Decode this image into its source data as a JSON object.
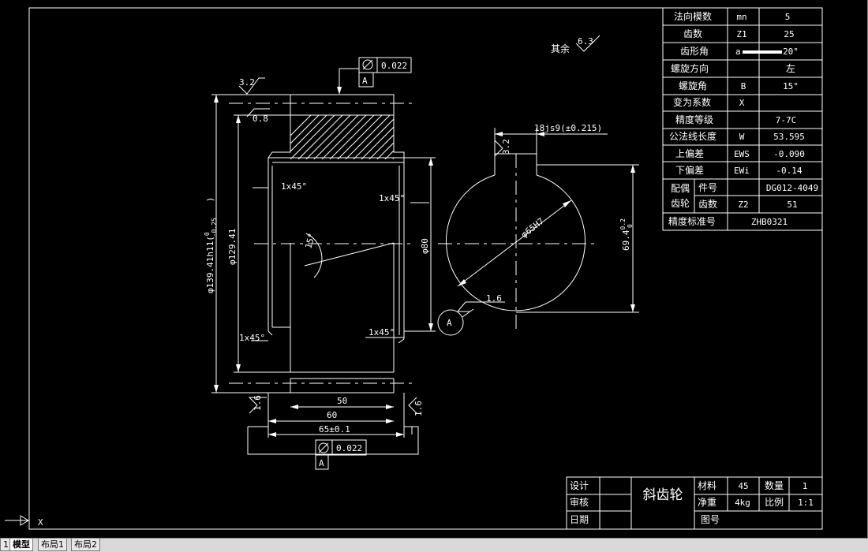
{
  "params": [
    {
      "name": "法向模数",
      "sym": "mn",
      "val": "5"
    },
    {
      "name": "齿数",
      "sym": "Z1",
      "val": "25"
    },
    {
      "name": "齿形角",
      "sym": "",
      "val": "20°"
    },
    {
      "name": "螺旋方向",
      "sym": "",
      "val": "左"
    },
    {
      "name": "螺旋角",
      "sym": "B",
      "val": "15°"
    },
    {
      "name": "变为系数",
      "sym": "X",
      "val": ""
    },
    {
      "name": "精度等级",
      "sym": "",
      "val": "7-7C"
    },
    {
      "name": "公法线长度",
      "sym": "W",
      "val": "53.595"
    },
    {
      "name": "上偏差",
      "sym": "EWS",
      "val": "-0.090"
    },
    {
      "name": "下偏差",
      "sym": "EWi",
      "val": "-0.14"
    }
  ],
  "mate": {
    "group_line1": "配偶",
    "group_line2": "齿轮",
    "part_label": "件号",
    "part_val": "DG012-4049",
    "teeth_label": "齿数",
    "teeth_sym": "Z2",
    "teeth_val": "51"
  },
  "std": {
    "label": "精度标准号",
    "val": "ZHB0321"
  },
  "title_block": {
    "design": "设计",
    "review": "审核",
    "date": "日期",
    "name": "斜齿轮",
    "material_label": "材料",
    "material": "45",
    "qty_label": "数量",
    "qty": "1",
    "weight_label": "净重",
    "weight": "4kg",
    "scale_label": "比例",
    "scale": "1:1",
    "drawing_no_label": "图号"
  },
  "annotations": {
    "rough_rest_label": "其余",
    "rough_rest_val": "6.3",
    "rough_top": "3.2",
    "rough_08": "0.8",
    "tol_top": "0.022",
    "tol_bottom": "0.022",
    "datum": "A",
    "ch_1": "1x45°",
    "ch_2": "1x45°",
    "ch_3": "1x45°",
    "ch_4": "1x45°",
    "dia_outer": "φ139.41h11(",
    "dia_outer_sup": "0",
    "dia_outer_sub": "-0.25",
    "dia_outer_close": ")",
    "dia_root": "φ129.41",
    "dia_bore": "φ80",
    "angle": "15°",
    "len_50": "50",
    "len_60": "60",
    "len_65": "65±0.1",
    "rough_16_left": "1.6",
    "rough_16_right": "1.6",
    "rough_16_circle": "1.6",
    "keyway": "18js9(±0.215)",
    "key_rough": "3.2",
    "hole": "φ65H7",
    "key_depth": "69.4",
    "key_depth_tol_top": "0.2",
    "key_depth_tol_bot": "0"
  },
  "tabs": [
    {
      "label": "模型"
    },
    {
      "label": "布局1"
    },
    {
      "label": "布局2"
    }
  ],
  "ucs": {
    "x_label": "X"
  }
}
